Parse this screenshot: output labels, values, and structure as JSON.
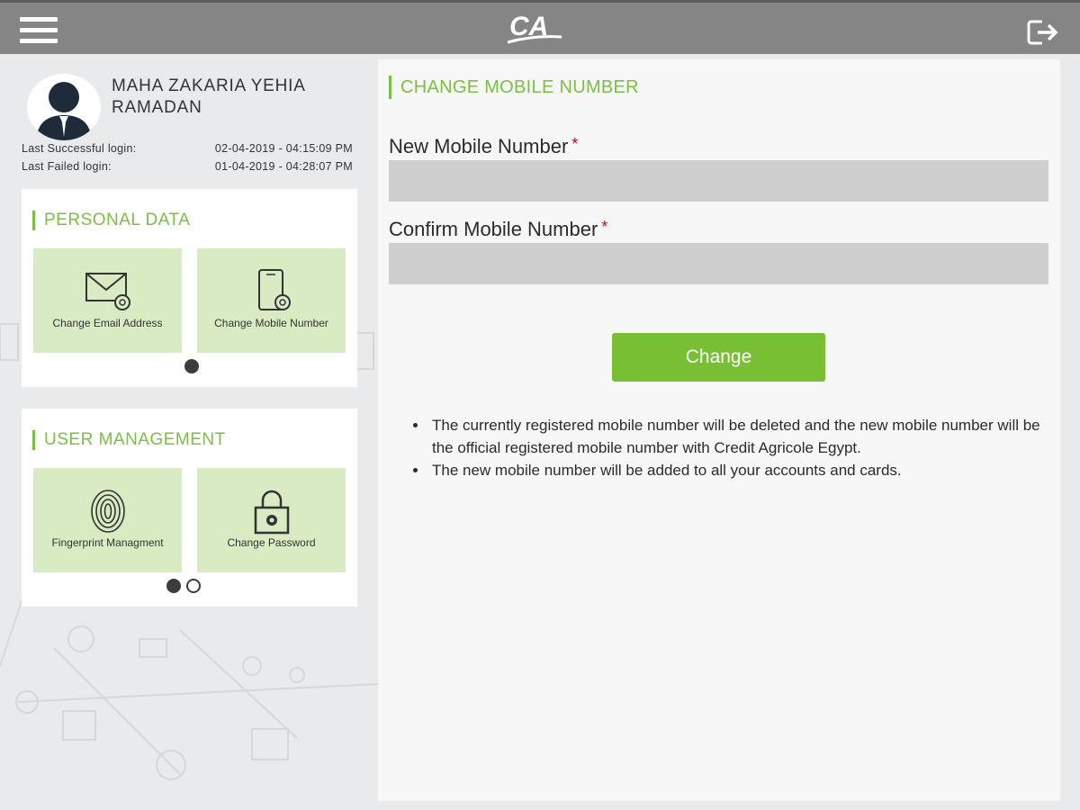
{
  "header": {
    "menu_icon": "hamburger-menu-icon",
    "logo_text": "CA",
    "logout_icon": "logout-icon"
  },
  "profile": {
    "name": "MAHA ZAKARIA YEHIA RAMADAN",
    "last_success_label": "Last Successful login:",
    "last_success_value": "02-04-2019 - 04:15:09 PM",
    "last_failed_label": "Last Failed login:",
    "last_failed_value": "01-04-2019 - 04:28:07 PM"
  },
  "personal_data": {
    "title": "PERSONAL DATA",
    "tiles": [
      {
        "label": "Change Email Address",
        "icon": "envelope-gear-icon"
      },
      {
        "label": "Change Mobile Number",
        "icon": "phone-gear-icon"
      }
    ]
  },
  "user_management": {
    "title": "USER MANAGEMENT",
    "tiles": [
      {
        "label": "Fingerprint Managment",
        "icon": "fingerprint-icon"
      },
      {
        "label": "Change Password",
        "icon": "lock-gear-icon"
      }
    ]
  },
  "main": {
    "title": "CHANGE MOBILE NUMBER",
    "new_label": "New Mobile Number",
    "confirm_label": "Confirm Mobile Number",
    "required_mark": "*",
    "new_value": "",
    "confirm_value": "",
    "button_label": "Change",
    "notes": [
      "The currently registered mobile number will be deleted and the new mobile number will be the official registered mobile number with Credit Agricole Egypt.",
      "The new mobile number will be added to all your accounts and cards."
    ]
  },
  "colors": {
    "accent": "#79c142",
    "button": "#78bf33",
    "topbar": "#858585",
    "tile": "#d8ebc2",
    "required": "#d0021b"
  }
}
